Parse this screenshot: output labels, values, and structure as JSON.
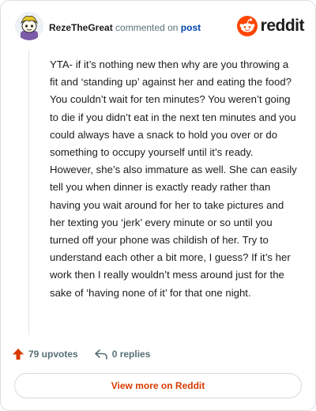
{
  "header": {
    "username": "RezeTheGreat",
    "commented_text": "commented on",
    "post_link_label": "post",
    "brand_label": "reddit"
  },
  "comment": {
    "text": "YTA- if it’s nothing new then why are you throwing a fit and ‘standing up’ against her and eating the food? You couldn’t wait for ten minutes? You weren’t going to die if you didn’t eat in the next ten minutes and you could always have a snack to hold you over or do something to occupy yourself until it’s ready. However, she’s also immature as well. She can easily tell you when dinner is exactly ready rather than having you wait around for her to take pictures and her texting you ‘jerk’ every minute or so until you turned off your phone was childish of her. Try to understand each other a bit more, I guess? If it’s her work then I really wouldn’t mess around just for the sake of ‘having none of it’ for that one night."
  },
  "actions": {
    "upvotes_label": "79 upvotes",
    "replies_label": "0 replies"
  },
  "footer": {
    "view_more_label": "View more on Reddit"
  },
  "icons": {
    "avatar": "avatar-icon",
    "brand": "reddit-logo-icon",
    "upvote": "upvote-arrow-icon",
    "reply": "reply-arrow-icon"
  },
  "colors": {
    "brand_orange": "#FF4500",
    "upvote_orange": "#D93A00",
    "link_blue": "#0045AC",
    "muted_text": "#576F76"
  }
}
